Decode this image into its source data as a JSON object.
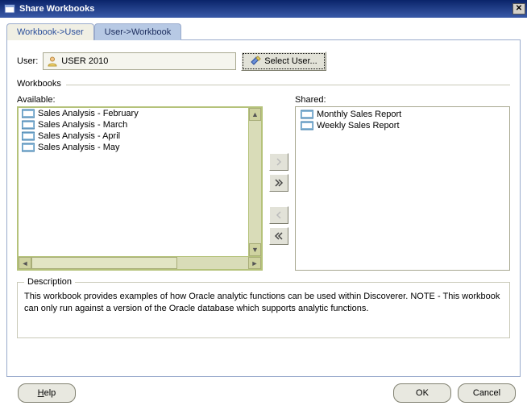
{
  "titlebar": {
    "title": "Share Workbooks"
  },
  "tabs": {
    "workbook_user": "Workbook->User",
    "user_workbook": "User->Workbook"
  },
  "user": {
    "label": "User:",
    "value": "USER 2010",
    "select_label": "Select User..."
  },
  "workbooks_label": "Workbooks",
  "available": {
    "label": "Available:",
    "items": [
      "Sales Analysis - February",
      "Sales Analysis - March",
      "Sales Analysis - April",
      "Sales Analysis - May"
    ]
  },
  "shared": {
    "label": "Shared:",
    "items": [
      "Monthly Sales Report",
      "Weekly Sales Report"
    ]
  },
  "description": {
    "legend": "Description",
    "text": "This workbook provides examples of how Oracle analytic functions can be used within Discoverer. NOTE - This workbook can only run against a version of the Oracle database which supports analytic functions."
  },
  "footer": {
    "help": "Help",
    "ok": "OK",
    "cancel": "Cancel"
  }
}
